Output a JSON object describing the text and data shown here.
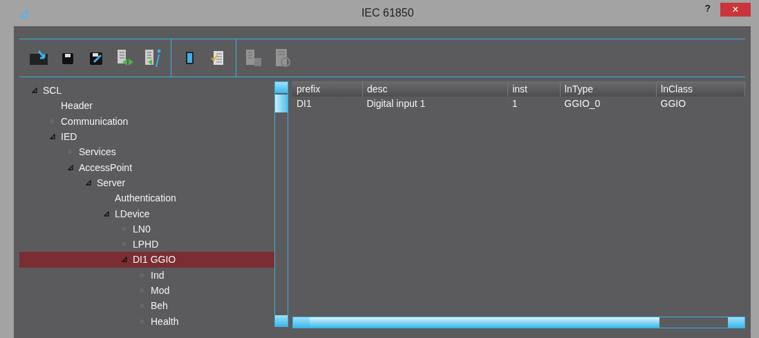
{
  "window": {
    "title": "IEC 61850",
    "help": "?",
    "close": "×"
  },
  "toolbar": [
    {
      "kind": "monitor-arrow",
      "disabled": false
    },
    {
      "kind": "floppy",
      "disabled": false
    },
    {
      "kind": "floppy-pen",
      "disabled": false
    },
    {
      "kind": "list-arrows",
      "disabled": false
    },
    {
      "kind": "list-info",
      "disabled": false
    },
    {
      "kind": "separator"
    },
    {
      "kind": "tablet",
      "disabled": false
    },
    {
      "kind": "list-check",
      "disabled": false
    },
    {
      "kind": "separator"
    },
    {
      "kind": "list-stack",
      "disabled": true
    },
    {
      "kind": "list-cycle",
      "disabled": true
    }
  ],
  "tree": [
    {
      "label": "SCL",
      "expanded": true,
      "selected": false,
      "children": [
        {
          "label": "Header",
          "selected": false
        },
        {
          "label": "Communication",
          "expanded": false,
          "selected": false
        },
        {
          "label": "IED",
          "expanded": true,
          "selected": false,
          "children": [
            {
              "label": "Services",
              "expanded": false,
              "selected": false
            },
            {
              "label": "AccessPoint",
              "expanded": true,
              "selected": false,
              "children": [
                {
                  "label": "Server",
                  "expanded": true,
                  "selected": false,
                  "children": [
                    {
                      "label": "Authentication",
                      "selected": false
                    },
                    {
                      "label": "LDevice",
                      "expanded": true,
                      "selected": false,
                      "children": [
                        {
                          "label": "LN0",
                          "expanded": false,
                          "selected": false
                        },
                        {
                          "label": "LPHD",
                          "expanded": false,
                          "selected": false
                        },
                        {
                          "label": "DI1 GGIO",
                          "expanded": true,
                          "selected": true,
                          "children": [
                            {
                              "label": "Ind",
                              "expanded": false,
                              "selected": false
                            },
                            {
                              "label": "Mod",
                              "expanded": false,
                              "selected": false
                            },
                            {
                              "label": "Beh",
                              "expanded": false,
                              "selected": false
                            },
                            {
                              "label": "Health",
                              "expanded": false,
                              "selected": false
                            }
                          ]
                        }
                      ]
                    }
                  ]
                }
              ]
            }
          ]
        }
      ]
    }
  ],
  "table": {
    "columns": [
      "prefix",
      "desc",
      "inst",
      "lnType",
      "lnClass"
    ],
    "rows": [
      [
        "DI1",
        "Digital input 1",
        "1",
        "GGIO_0",
        "GGIO"
      ]
    ]
  }
}
